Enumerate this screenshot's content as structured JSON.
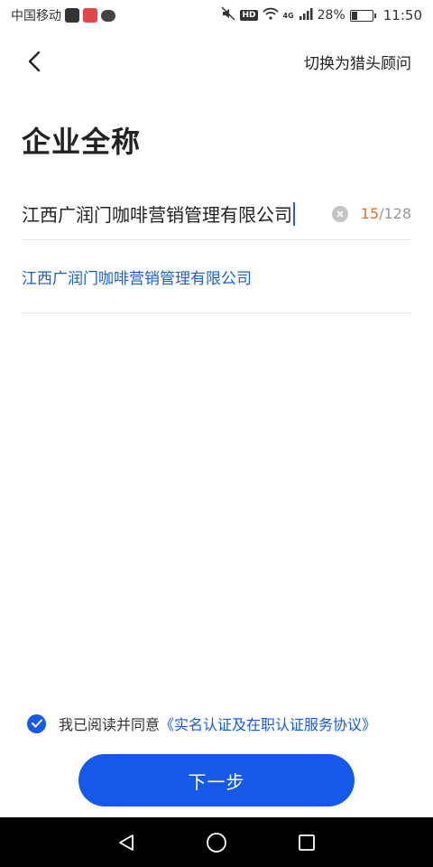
{
  "status_bar": {
    "carrier": "中国移动",
    "battery_percent": "28%",
    "time": "11:50",
    "network": "4G",
    "hd_label": "HD",
    "icons": [
      "video-app-icon",
      "heart-app-icon",
      "message-bubble-icon",
      "mute-icon",
      "hd-icon",
      "wifi-icon",
      "signal-icon",
      "battery-icon"
    ]
  },
  "header": {
    "back_icon": "chevron-left-icon",
    "switch_label": "切换为猎头顾问"
  },
  "page": {
    "title": "企业全称"
  },
  "company_input": {
    "value": "江西广润门咖啡营销管理有限公司",
    "char_count": "15",
    "char_limit": "/128",
    "clear_icon": "clear-circle-icon"
  },
  "suggestions": [
    {
      "label": "江西广润门咖啡营销管理有限公司"
    }
  ],
  "agreement": {
    "checked": true,
    "text": "我已阅读并同意",
    "link": "《实名认证及在职认证服务协议》"
  },
  "next_button": {
    "label": "下一步"
  },
  "system_nav": {
    "icons": [
      "back-triangle-icon",
      "home-circle-icon",
      "recents-square-icon"
    ]
  },
  "colors": {
    "accent": "#1659e8",
    "counter_highlight": "#f06d20",
    "link": "#1a5fd6"
  }
}
